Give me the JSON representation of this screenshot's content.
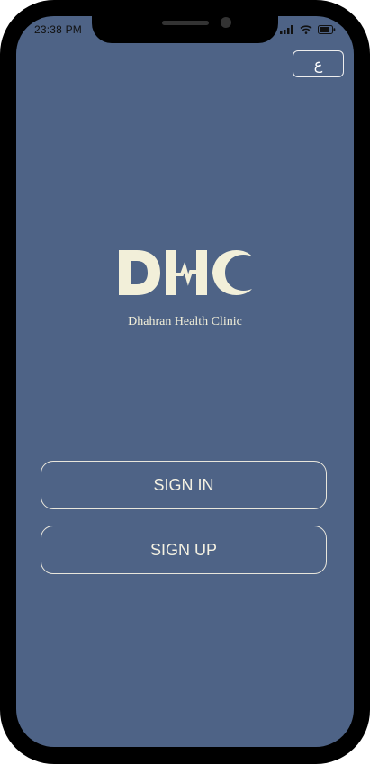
{
  "status_bar": {
    "time": "23:38 PM",
    "icons": [
      "cellular-signal-icon",
      "wifi-icon",
      "battery-icon"
    ]
  },
  "header": {
    "language_toggle_label": "ع"
  },
  "brand": {
    "logo_text": "DHC",
    "clinic_name": "Dhahran Health Clinic"
  },
  "actions": {
    "sign_in_label": "SIGN IN",
    "sign_up_label": "SIGN UP"
  },
  "colors": {
    "background": "#4e6386",
    "logo_cream": "#f2efd9",
    "frame": "#000000"
  }
}
